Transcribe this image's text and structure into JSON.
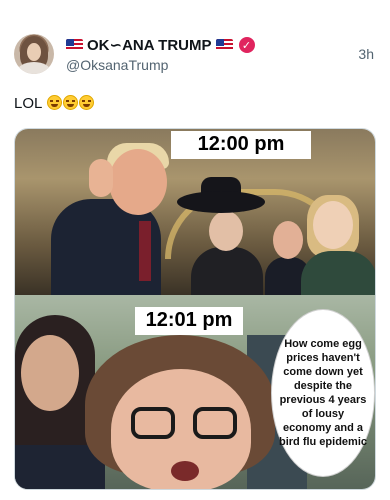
{
  "post": {
    "display_name": "OK∽ANA TRUMP",
    "handle": "@OksanaTrump",
    "timestamp": "3h",
    "text": "LOL",
    "emoji_count": 3
  },
  "meme": {
    "top_caption": "12:00 pm",
    "bottom_caption": "12:01 pm",
    "speech_bubble": "How come egg prices haven't come down yet despite the previous 4 years of lousy economy and a bird flu epidemic"
  },
  "colors": {
    "verified_badge": "#e0245e",
    "secondary_text": "#536471"
  },
  "icons": [
    "avatar",
    "us-flag-icon",
    "verified-badge-icon",
    "laughing-emoji-icon"
  ]
}
